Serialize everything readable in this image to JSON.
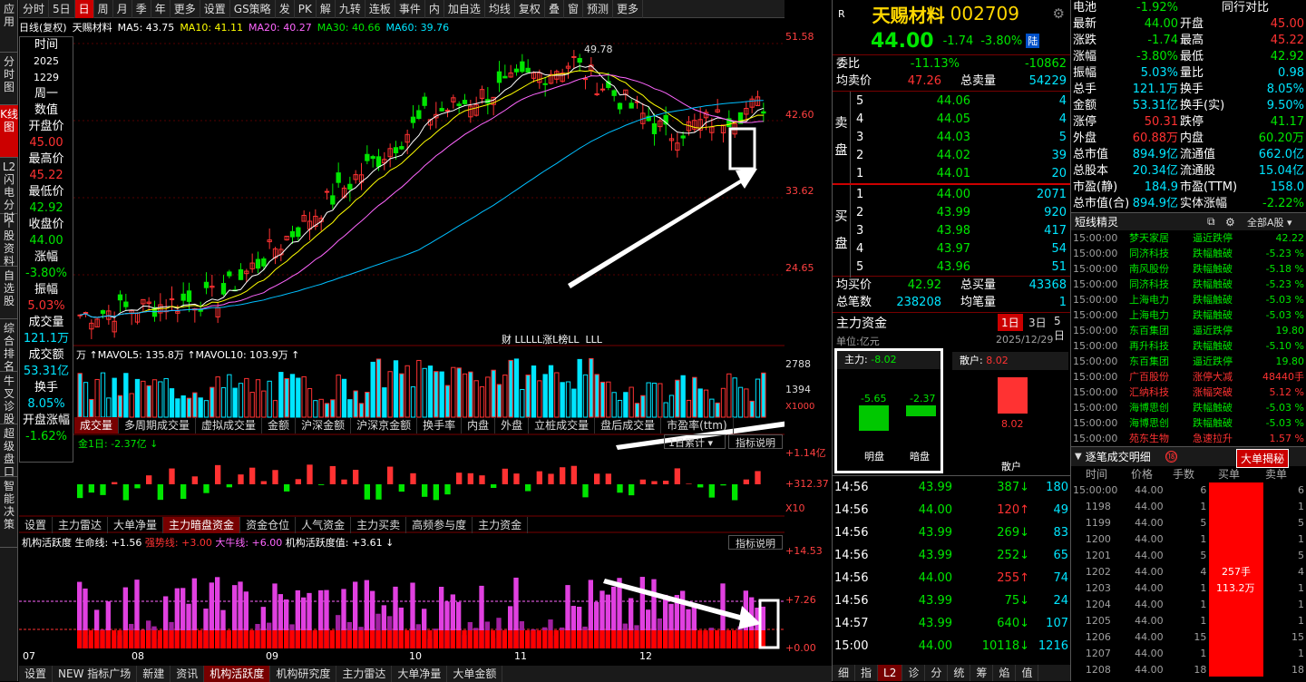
{
  "sidebar": [
    "应用",
    "分时图",
    "K线图",
    "L2闪电分时",
    "个股资料",
    "自选股",
    "综合排名",
    "牛叉诊股",
    "超级盘口",
    "智能决策"
  ],
  "toolbar": [
    "分时",
    "5日",
    "日",
    "周",
    "月",
    "季",
    "年",
    "更多",
    "设置",
    "GS策略",
    "发",
    "PK",
    "解",
    "九转",
    "连板",
    "事件",
    "内",
    "加自选",
    "均线",
    "复权",
    "叠",
    "窗",
    "预测",
    "更多"
  ],
  "chart_info": {
    "period": "日线(复权)",
    "name": "天赐材料",
    "ma5": "MA5: 43.75",
    "ma10": "MA10: 41.11",
    "ma20": "MA20: 40.27",
    "ma30": "MA30: 40.66",
    "ma60": "MA60: 39.76"
  },
  "axis": {
    "p1": "51.58",
    "p2": "42.60",
    "p3": "33.62",
    "p4": "24.65",
    "v1": "2788",
    "v2": "1394",
    "v3": "X1000",
    "f1": "+1.14亿",
    "f2": "+312.37",
    "f3": "X10",
    "a1": "+14.53",
    "a2": "+7.26",
    "a3": "+0.00"
  },
  "peak_label": "49.78",
  "left_info": [
    [
      "时间",
      "2025",
      "1229",
      "周一",
      "数值"
    ],
    [
      "开盘价",
      "45.00"
    ],
    [
      "最高价",
      "45.22"
    ],
    [
      "最低价",
      "42.92"
    ],
    [
      "收盘价",
      "44.00"
    ],
    [
      "涨幅",
      "-3.80%"
    ],
    [
      "振幅",
      "5.03%"
    ],
    [
      "成交量",
      "121.1万"
    ],
    [
      "成交额",
      "53.31亿"
    ],
    [
      "换手",
      "8.05%"
    ],
    [
      "开盘涨幅",
      "-1.62%"
    ]
  ],
  "events": "财 LLLLL涨L榜LL  LLL",
  "vol_info": "万 ↑MAVOL5: 135.8万 ↑MAVOL10: 103.9万 ↑",
  "vol_tabs": [
    "成交量",
    "多周期成交量",
    "虚拟成交量",
    "金额",
    "沪深金额",
    "沪深京金额",
    "换手率",
    "内盘",
    "外盘",
    "立桩成交量",
    "盘后成交量",
    "市盈率(ttm)"
  ],
  "fund_info": "金1日: -2.37亿 ↓",
  "fund_sel": "1日累计",
  "explain": "指标说明",
  "fund_tabs": [
    "设置",
    "主力雷达",
    "大单净量",
    "主力暗盘资金",
    "资金仓位",
    "人气资金",
    "主力买卖",
    "高频参与度",
    "主力资金"
  ],
  "act_info": {
    "a": "机构活跃度",
    "b": "生命线: +1.56",
    "c": "强势线: +3.00",
    "d": "大牛线: +6.00",
    "e": "机构活跃度值: +3.61 ↓"
  },
  "months": [
    "07",
    "08",
    "09",
    "10",
    "11",
    "12"
  ],
  "bottom_tabs": [
    "设置",
    "NEW 指标广场",
    "新建",
    "资讯",
    "机构活跃度",
    "机构研究度",
    "主力雷达",
    "大单净量",
    "大单金额"
  ],
  "stock": {
    "name": "天赐材料",
    "code": "002709",
    "price": "44.00",
    "chg": "-1.74",
    "pct": "-3.80%",
    "tag": "陆"
  },
  "weibi": {
    "l1": "委比",
    "v1": "-11.13%",
    "v2": "-10862",
    "l2": "均卖价",
    "v3": "47.26",
    "l3": "总卖量",
    "v4": "54229"
  },
  "sell": [
    [
      "5",
      "44.06",
      "4"
    ],
    [
      "4",
      "44.05",
      "4"
    ],
    [
      "3",
      "44.03",
      "5"
    ],
    [
      "2",
      "44.02",
      "39"
    ],
    [
      "1",
      "44.01",
      "20"
    ]
  ],
  "buy": [
    [
      "1",
      "44.00",
      "2071"
    ],
    [
      "2",
      "43.99",
      "920"
    ],
    [
      "3",
      "43.98",
      "417"
    ],
    [
      "4",
      "43.97",
      "54"
    ],
    [
      "5",
      "43.96",
      "51"
    ]
  ],
  "sell_label": "卖盘",
  "buy_label": "买盘",
  "junmai": {
    "l1": "均买价",
    "v1": "42.92",
    "l2": "总买量",
    "v2": "43368",
    "l3": "总笔数",
    "v3": "238208",
    "l4": "均笔量",
    "v4": "1"
  },
  "zhuli": {
    "title": "主力资金",
    "d1": "1日",
    "d2": "3日",
    "d3": "5日",
    "unit": "单位:亿元",
    "date": "2025/12/29",
    "main": "主力:",
    "mainv": "-8.02",
    "b1": "-5.65",
    "b2": "-2.37",
    "l1": "明盘",
    "l2": "暗盘",
    "retail": "散户:",
    "retailv": "8.02",
    "rv": "8.02",
    "rl": "散户"
  },
  "ticks": [
    [
      "14:56",
      "43.99",
      "387",
      "180",
      "down"
    ],
    [
      "14:56",
      "44.00",
      "120",
      "49",
      "up"
    ],
    [
      "14:56",
      "43.99",
      "269",
      "83",
      "down"
    ],
    [
      "14:56",
      "43.99",
      "252",
      "65",
      "down"
    ],
    [
      "14:56",
      "44.00",
      "255",
      "74",
      "up"
    ],
    [
      "14:56",
      "43.99",
      "75",
      "24",
      "down"
    ],
    [
      "14:57",
      "43.99",
      "640",
      "107",
      "down"
    ],
    [
      "15:00",
      "44.00",
      "10118",
      "1216",
      "down"
    ]
  ],
  "quote_tabs": [
    "细",
    "指",
    "L2",
    "诊",
    "分",
    "统",
    "筹",
    "焰",
    "值"
  ],
  "stats": [
    [
      "电池",
      "-1.92%",
      "同行对比",
      ""
    ],
    [
      "最新",
      "44.00",
      "开盘",
      "45.00"
    ],
    [
      "涨跌",
      "-1.74",
      "最高",
      "45.22"
    ],
    [
      "涨幅",
      "-3.80%",
      "最低",
      "42.92"
    ],
    [
      "振幅",
      "5.03%",
      "量比",
      "0.98"
    ],
    [
      "总手",
      "121.1万",
      "换手",
      "8.05%"
    ],
    [
      "金额",
      "53.31亿",
      "换手(实)",
      "9.50%"
    ],
    [
      "涨停",
      "50.31",
      "跌停",
      "41.17"
    ],
    [
      "外盘",
      "60.88万",
      "内盘",
      "60.20万"
    ],
    [
      "总市值",
      "894.9亿",
      "流通值",
      "662.0亿"
    ],
    [
      "总股本",
      "20.34亿",
      "流通股",
      "15.04亿"
    ],
    [
      "市盈(静)",
      "184.9",
      "市盈(TTM)",
      "158.0"
    ],
    [
      "总市值(合)",
      "894.9亿",
      "实体涨幅",
      "-2.22%"
    ]
  ],
  "jingling": {
    "title": "短线精灵",
    "sel": "全部A股"
  },
  "jl": [
    [
      "15:00:00",
      "梦天家居",
      "逼近跌停",
      "42.22"
    ],
    [
      "15:00:00",
      "同济科技",
      "跌幅触破",
      "-5.23 %"
    ],
    [
      "15:00:00",
      "南风股份",
      "跌幅触破",
      "-5.18 %"
    ],
    [
      "15:00:00",
      "同济科技",
      "跌幅触破",
      "-5.23 %"
    ],
    [
      "15:00:00",
      "上海电力",
      "跌幅触破",
      "-5.03 %"
    ],
    [
      "15:00:00",
      "上海电力",
      "跌幅触破",
      "-5.03 %"
    ],
    [
      "15:00:00",
      "东百集团",
      "逼近跌停",
      "19.80"
    ],
    [
      "15:00:00",
      "再升科技",
      "跌幅触破",
      "-5.10 %"
    ],
    [
      "15:00:00",
      "东百集团",
      "逼近跌停",
      "19.80"
    ],
    [
      "15:00:00",
      "广百股份",
      "涨停大减",
      "48440手"
    ],
    [
      "15:00:00",
      "汇纳科技",
      "涨幅突破",
      "5.12 %"
    ],
    [
      "15:00:00",
      "海博思创",
      "跌幅触破",
      "-5.03 %"
    ],
    [
      "15:00:00",
      "海博思创",
      "跌幅触破",
      "-5.03 %"
    ],
    [
      "15:00:00",
      "苑东生物",
      "急速拉升",
      "1.57 %"
    ]
  ],
  "detail": {
    "title": "逐笔成交明细",
    "btn": "大单揭秘",
    "h": [
      "时间",
      "价格",
      "手数",
      "买单",
      "卖单"
    ],
    "big1": "257手",
    "big2": "113.2万"
  },
  "detail_rows": [
    [
      "15:00:00",
      "44.00",
      "6",
      "6"
    ],
    [
      "1198",
      "44.00",
      "1",
      "1"
    ],
    [
      "1199",
      "44.00",
      "5",
      "5"
    ],
    [
      "1200",
      "44.00",
      "1",
      "1"
    ],
    [
      "1201",
      "44.00",
      "5",
      "5"
    ],
    [
      "1202",
      "44.00",
      "4",
      "4"
    ],
    [
      "1203",
      "44.00",
      "1",
      "1"
    ],
    [
      "1204",
      "44.00",
      "1",
      "1"
    ],
    [
      "1205",
      "44.00",
      "1",
      "1"
    ],
    [
      "1206",
      "44.00",
      "15",
      "15"
    ],
    [
      "1207",
      "44.00",
      "1",
      "1"
    ],
    [
      "1208",
      "44.00",
      "18",
      "18"
    ]
  ]
}
